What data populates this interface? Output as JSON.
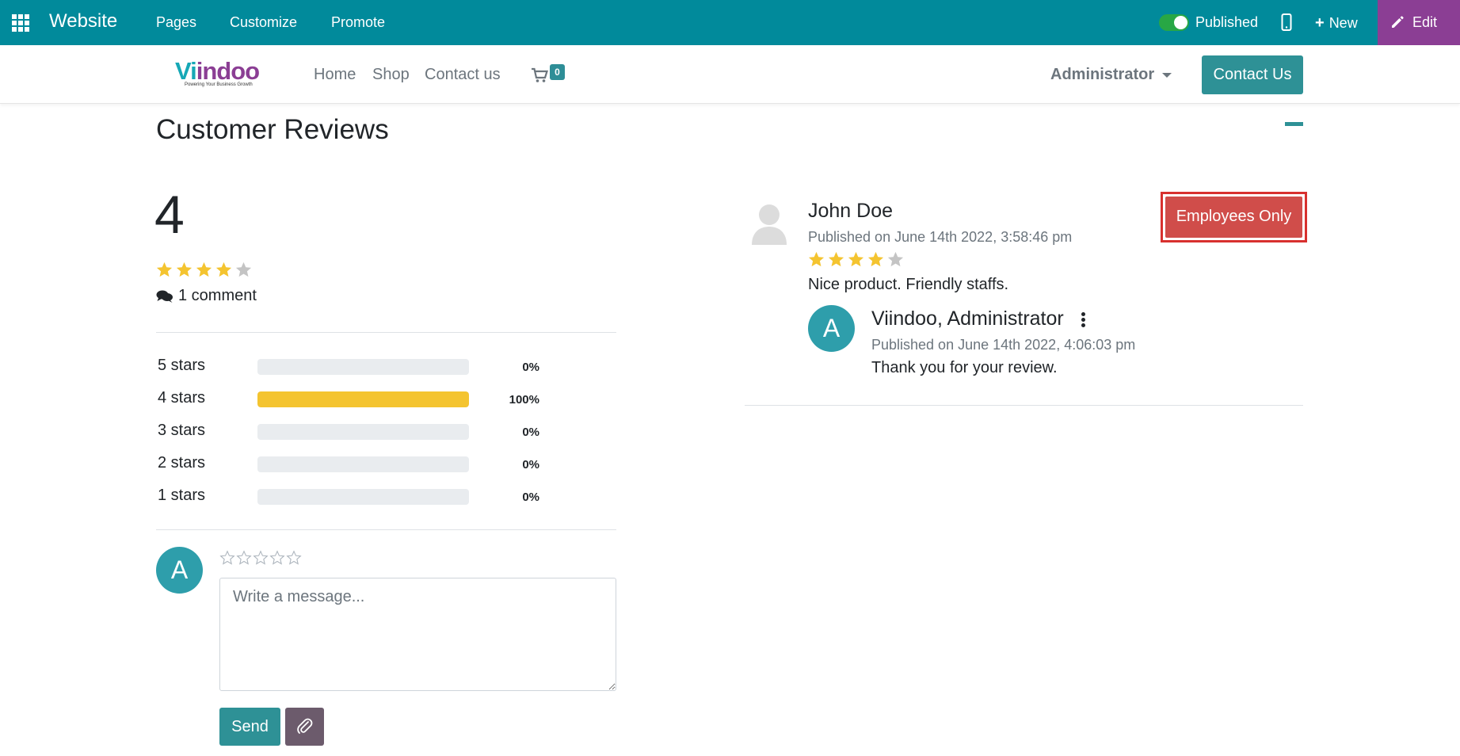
{
  "topbar": {
    "brand": "Website",
    "menu": [
      "Pages",
      "Customize",
      "Promote"
    ],
    "published_label": "Published",
    "new_label": "New",
    "edit_label": "Edit"
  },
  "header": {
    "logo_text_1": "Vi",
    "logo_text_2": "indoo",
    "logo_tagline": "Powering Your Business Growth",
    "nav": [
      "Home",
      "Shop",
      "Contact us"
    ],
    "cart_count": "0",
    "user_menu": "Administrator",
    "contact_button": "Contact Us"
  },
  "reviews": {
    "title": "Customer Reviews",
    "average": "4",
    "average_stars": 4,
    "comment_count_label": "1 comment",
    "stats": [
      {
        "label": "5 stars",
        "percent": "0%",
        "value": 0
      },
      {
        "label": "4 stars",
        "percent": "100%",
        "value": 100
      },
      {
        "label": "3 stars",
        "percent": "0%",
        "value": 0
      },
      {
        "label": "2 stars",
        "percent": "0%",
        "value": 0
      },
      {
        "label": "1 stars",
        "percent": "0%",
        "value": 0
      }
    ],
    "composer": {
      "avatar_letter": "A",
      "placeholder": "Write a message...",
      "send_label": "Send"
    }
  },
  "review": {
    "author": "John Doe",
    "published": "Published on June 14th 2022, 3:58:46 pm",
    "stars": 4,
    "text": "Nice product. Friendly staffs.",
    "badge": "Employees Only",
    "reply": {
      "avatar_letter": "A",
      "author": "Viindoo, Administrator",
      "published": "Published on June 14th 2022, 4:06:03 pm",
      "text": "Thank you for your review."
    }
  },
  "colors": {
    "topbar": "#018a9b",
    "edit": "#8b3e94",
    "accent": "#2e9196",
    "star": "#f4c430",
    "danger": "#d04d4a"
  }
}
